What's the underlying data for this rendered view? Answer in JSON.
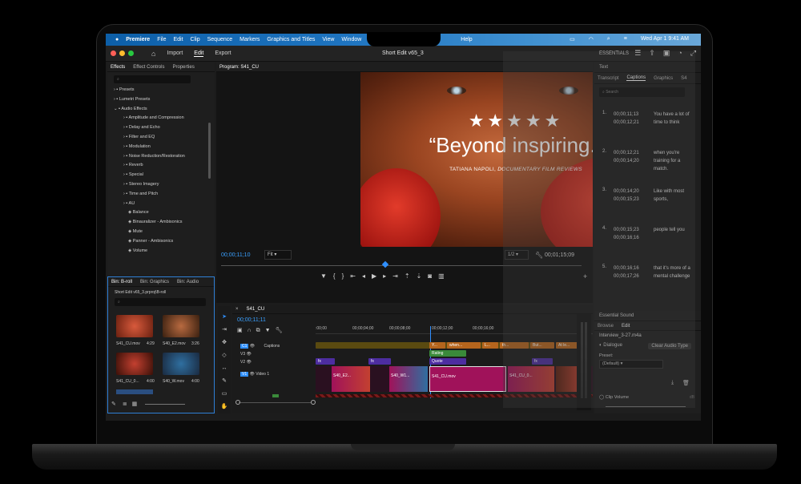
{
  "menubar": {
    "apple": "",
    "items": [
      "Premiere",
      "File",
      "Edit",
      "Clip",
      "Sequence",
      "Markers",
      "Graphics and Titles",
      "View",
      "Window"
    ],
    "help": "Help",
    "datetime": "Wed Apr 1  9:41 AM"
  },
  "header": {
    "nav": [
      "Import",
      "Edit",
      "Export"
    ],
    "active_nav": "Edit",
    "title": "Short Edit v65_3",
    "essentials": "ESSENTIALS"
  },
  "effects_panel": {
    "tabs": [
      "Effects",
      "Effect Controls",
      "Properties"
    ],
    "items": [
      {
        "label": "Presets",
        "level": 1
      },
      {
        "label": "Lumetri Presets",
        "level": 1
      },
      {
        "label": "Audio Effects",
        "level": 1
      },
      {
        "label": "Amplitude and Compression",
        "level": 2
      },
      {
        "label": "Delay and Echo",
        "level": 2
      },
      {
        "label": "Filter and EQ",
        "level": 2
      },
      {
        "label": "Modulation",
        "level": 2
      },
      {
        "label": "Noise Reduction/Restoration",
        "level": 2
      },
      {
        "label": "Reverb",
        "level": 2
      },
      {
        "label": "Special",
        "level": 2
      },
      {
        "label": "Stereo Imagery",
        "level": 2
      },
      {
        "label": "Time and Pitch",
        "level": 2
      },
      {
        "label": "AU",
        "level": 2
      },
      {
        "label": "Balance",
        "level": 3
      },
      {
        "label": "Binauralizer - Ambisonics",
        "level": 3
      },
      {
        "label": "Mute",
        "level": 3
      },
      {
        "label": "Panner - Ambisonics",
        "level": 3
      },
      {
        "label": "Volume",
        "level": 3
      }
    ]
  },
  "bin_panel": {
    "tabs": [
      "Bin: B-roll",
      "Bin: Graphics",
      "Bin: Audio"
    ],
    "path": "Short Edit v65_3.prproj\\B-roll",
    "clips": [
      {
        "name": "S41_CU.mov",
        "dur": "4:29"
      },
      {
        "name": "S40_E2.mov",
        "dur": "3:26"
      },
      {
        "name": "S41_CU_0...",
        "dur": "4:00"
      },
      {
        "name": "S40_W.mov",
        "dur": "4:00"
      }
    ]
  },
  "program": {
    "label": "Program: S41_CU",
    "stars": "★★★★★",
    "quote": "“Beyond inspiring.”",
    "byline_name": "TATIANA NAPOLI, ",
    "byline_source": "DOCUMENTARY FILM REVIEWS",
    "timecode_current": "00;00;11;10",
    "fit": "Fit",
    "resolution": "1/2",
    "timecode_duration": "00;01;15;09"
  },
  "captions_panel": {
    "panel_title": "Text",
    "tabs": [
      "Transcript",
      "Captions",
      "Graphics",
      "S4"
    ],
    "active_tab": "Captions",
    "search_placeholder": "Search",
    "rows": [
      {
        "num": "1.",
        "start": "00;00;11;13",
        "end": "00;00;12;21",
        "text": "You have a lot of time to think"
      },
      {
        "num": "2.",
        "start": "00;00;12;21",
        "end": "00;00;14;20",
        "text": "when you're training for a match."
      },
      {
        "num": "3.",
        "start": "00;00;14;20",
        "end": "00;00;15;23",
        "text": "Like with most sports,"
      },
      {
        "num": "4.",
        "start": "00;00;15;23",
        "end": "00;00;16;16",
        "text": "people tell you"
      },
      {
        "num": "5.",
        "start": "00;00;16;16",
        "end": "00;00;17;26",
        "text": "that it's more of a mental challenge"
      }
    ]
  },
  "essential_sound": {
    "title": "Essential Sound",
    "tabs": [
      "Browse",
      "Edit"
    ],
    "file": "Interview_3-27.m4a",
    "type": "Dialogue",
    "clear_button": "Clear Audio Type",
    "preset_label": "Preset:",
    "preset_value": "(Default)",
    "clip_volume": "Clip Volume",
    "db_label": "dB"
  },
  "timeline": {
    "sequence": "S41_CU",
    "timecode": "00;00;11;11",
    "ruler": [
      ":00;00",
      "00;00;04;00",
      "00;00;08;00",
      "00;00;12;00",
      "00;00;16;00"
    ],
    "tracks": {
      "c1": "C1",
      "v3": "V3",
      "v2": "V2",
      "v1": "V1",
      "video1": "Video 1",
      "captions": "Captions"
    },
    "caption_clips": [
      "Y...",
      "when...",
      "L...",
      "th...",
      "But...",
      "At le..."
    ],
    "graphic_clips": [
      "Rating",
      "Quote"
    ],
    "fx": "fx",
    "video_clips": [
      "S40_E2...",
      "S40_W1...",
      "S41_CU.mov",
      "S41_CU_0..."
    ]
  },
  "colors": {
    "accent_blue": "#2f8fff",
    "clip_magenta": "#a0125a",
    "clip_purple": "#4d2da0",
    "caption_orange": "#b5651d",
    "graphic_green": "#3a8a3a"
  }
}
